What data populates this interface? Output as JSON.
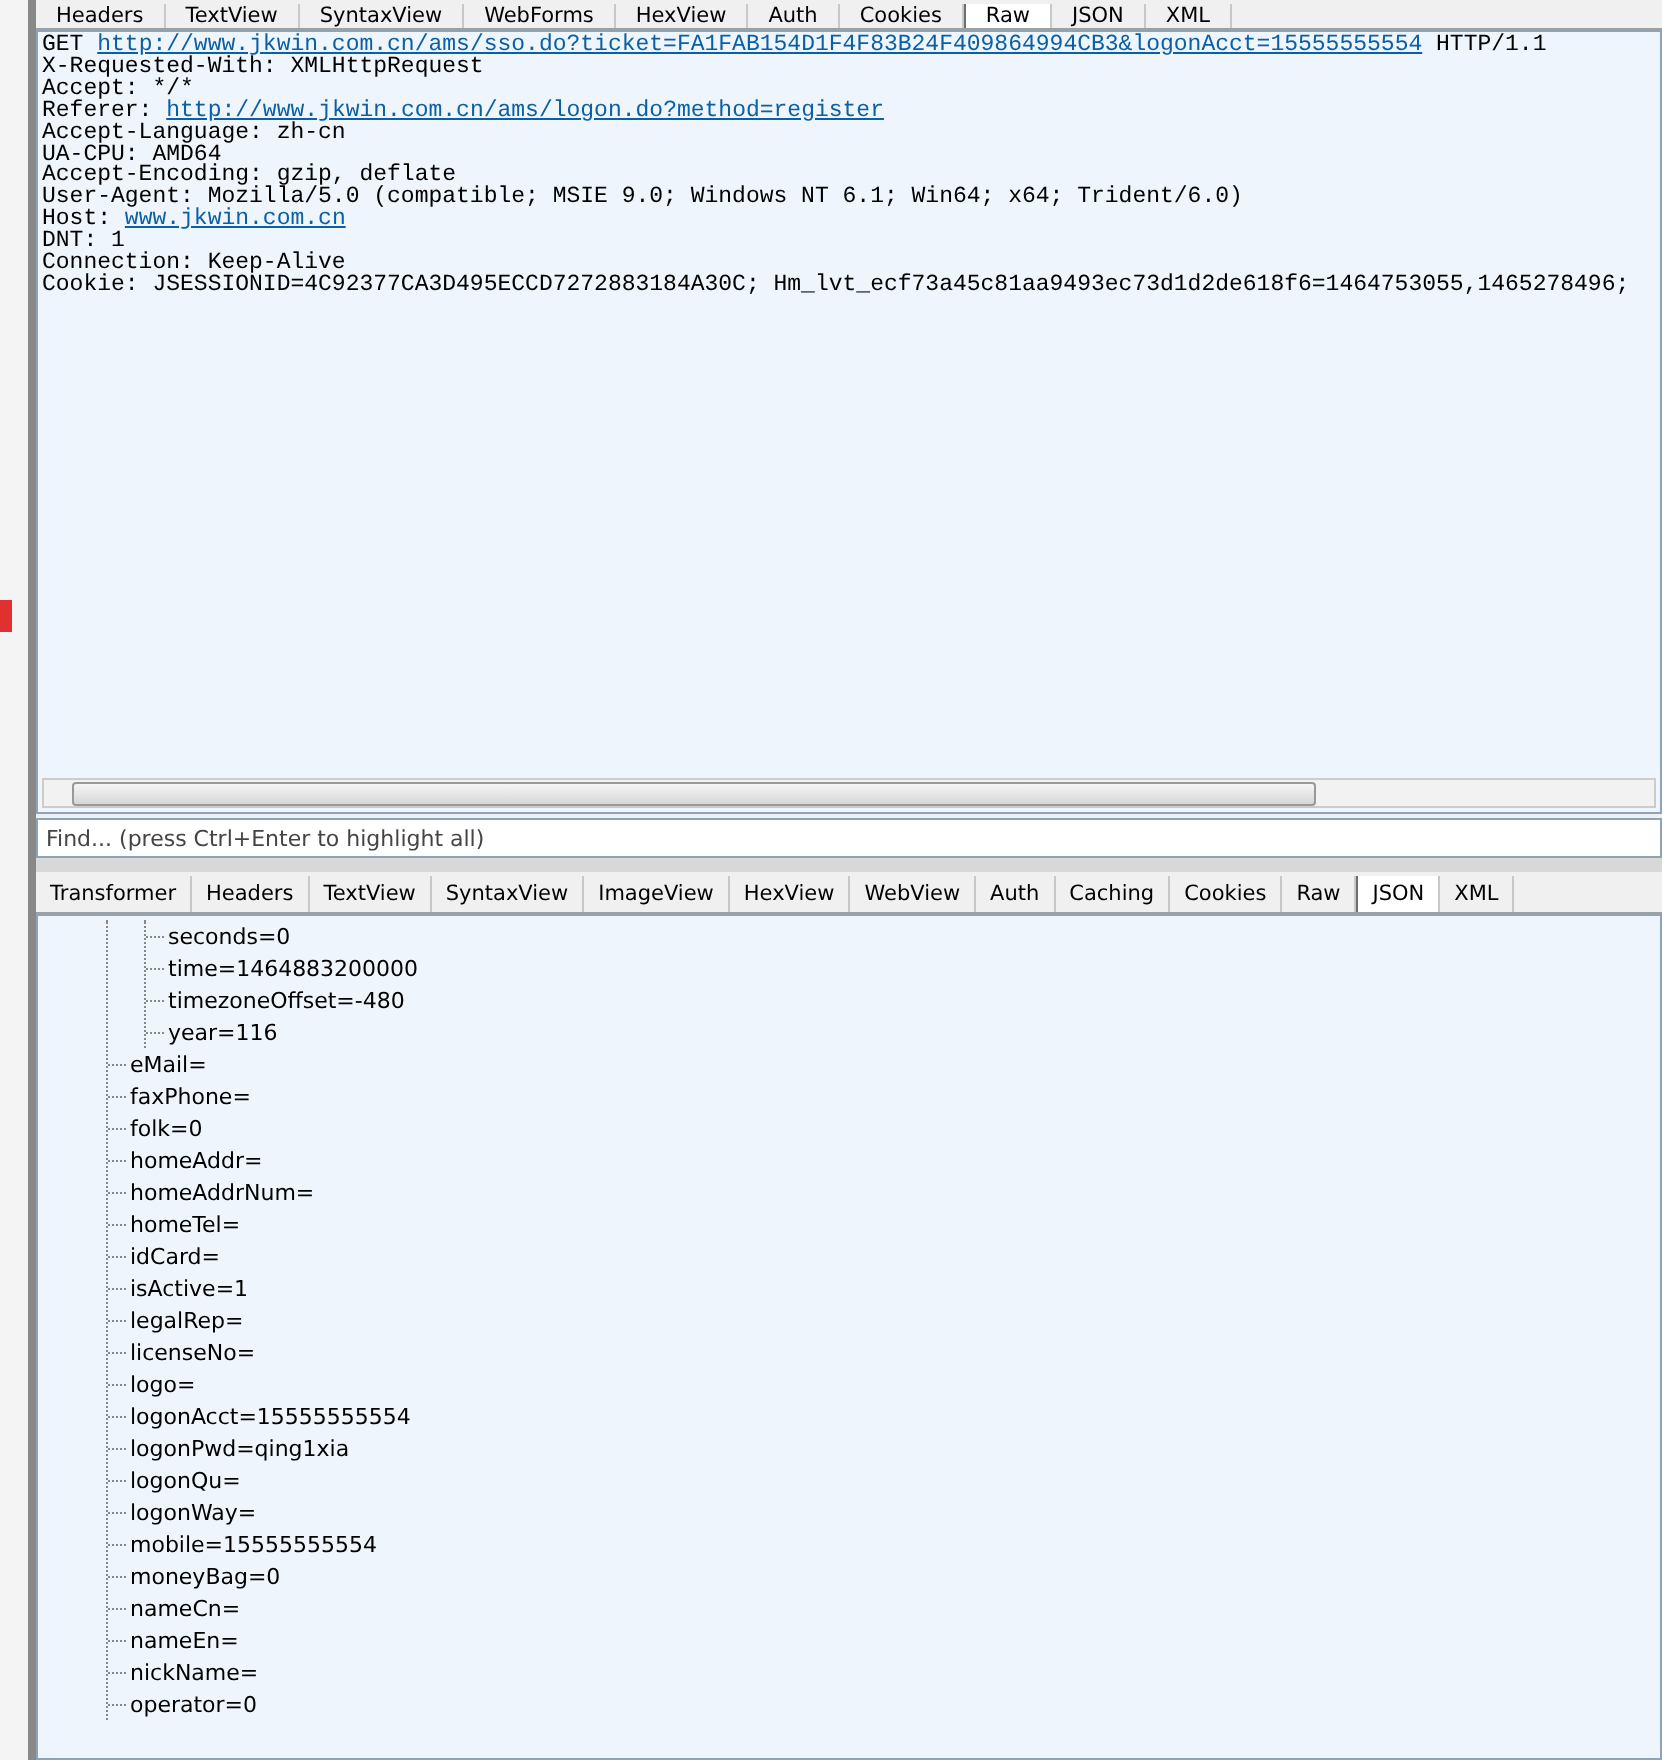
{
  "request_tabs": [
    {
      "label": "Headers",
      "selected": false
    },
    {
      "label": "TextView",
      "selected": false
    },
    {
      "label": "SyntaxView",
      "selected": false
    },
    {
      "label": "WebForms",
      "selected": false
    },
    {
      "label": "HexView",
      "selected": false
    },
    {
      "label": "Auth",
      "selected": false
    },
    {
      "label": "Cookies",
      "selected": false
    },
    {
      "label": "Raw",
      "selected": true
    },
    {
      "label": "JSON",
      "selected": false
    },
    {
      "label": "XML",
      "selected": false
    }
  ],
  "request_lines": [
    [
      {
        "kind": "text",
        "text": "GET "
      },
      {
        "kind": "link",
        "text": "http://www.jkwin.com.cn/ams/sso.do?ticket=FA1FAB154D1F4F83B24F409864994CB3&logonAcct=15555555554"
      },
      {
        "kind": "text",
        "text": " HTTP/1.1"
      }
    ],
    [
      {
        "kind": "text",
        "text": "X-Requested-With: XMLHttpRequest"
      }
    ],
    [
      {
        "kind": "text",
        "text": "Accept: */*"
      }
    ],
    [
      {
        "kind": "text",
        "text": "Referer: "
      },
      {
        "kind": "link",
        "text": "http://www.jkwin.com.cn/ams/logon.do?method=register"
      }
    ],
    [
      {
        "kind": "text",
        "text": "Accept-Language: zh-cn"
      }
    ],
    [
      {
        "kind": "text",
        "text": "UA-CPU: AMD64"
      }
    ],
    [
      {
        "kind": "text",
        "text": "Accept-Encoding: gzip, deflate"
      }
    ],
    [
      {
        "kind": "text",
        "text": "User-Agent: Mozilla/5.0 (compatible; MSIE 9.0; Windows NT 6.1; Win64; x64; Trident/6.0)"
      }
    ],
    [
      {
        "kind": "text",
        "text": "Host: "
      },
      {
        "kind": "link",
        "text": "www.jkwin.com.cn"
      }
    ],
    [
      {
        "kind": "text",
        "text": "DNT: 1"
      }
    ],
    [
      {
        "kind": "text",
        "text": "Connection: Keep-Alive"
      }
    ],
    [
      {
        "kind": "text",
        "text": "Cookie: JSESSIONID=4C92377CA3D495ECCD7272883184A30C; Hm_lvt_ecf73a45c81aa9493ec73d1d2de618f6=1464753055,1465278496;"
      }
    ]
  ],
  "find": {
    "placeholder": "Find... (press Ctrl+Enter to highlight all)"
  },
  "response_tabs": [
    {
      "label": "Transformer",
      "selected": false
    },
    {
      "label": "Headers",
      "selected": false
    },
    {
      "label": "TextView",
      "selected": false
    },
    {
      "label": "SyntaxView",
      "selected": false
    },
    {
      "label": "ImageView",
      "selected": false
    },
    {
      "label": "HexView",
      "selected": false
    },
    {
      "label": "WebView",
      "selected": false
    },
    {
      "label": "Auth",
      "selected": false
    },
    {
      "label": "Caching",
      "selected": false
    },
    {
      "label": "Cookies",
      "selected": false
    },
    {
      "label": "Raw",
      "selected": false
    },
    {
      "label": "JSON",
      "selected": true
    },
    {
      "label": "XML",
      "selected": false
    }
  ],
  "tree": [
    {
      "children": [
        {
          "label": "seconds=0"
        },
        {
          "label": "time=1464883200000"
        },
        {
          "label": "timezoneOffset=-480"
        },
        {
          "label": "year=116"
        }
      ]
    },
    {
      "label": "eMail="
    },
    {
      "label": "faxPhone="
    },
    {
      "label": "folk=0"
    },
    {
      "label": "homeAddr="
    },
    {
      "label": "homeAddrNum="
    },
    {
      "label": "homeTel="
    },
    {
      "label": "idCard="
    },
    {
      "label": "isActive=1"
    },
    {
      "label": "legalRep="
    },
    {
      "label": "licenseNo="
    },
    {
      "label": "logo="
    },
    {
      "label": "logonAcct=15555555554"
    },
    {
      "label": "logonPwd=qing1xia"
    },
    {
      "label": "logonQu="
    },
    {
      "label": "logonWay="
    },
    {
      "label": "mobile=15555555554"
    },
    {
      "label": "moneyBag=0"
    },
    {
      "label": "nameCn="
    },
    {
      "label": "nameEn="
    },
    {
      "label": "nickName="
    },
    {
      "label": "operator=0"
    }
  ]
}
